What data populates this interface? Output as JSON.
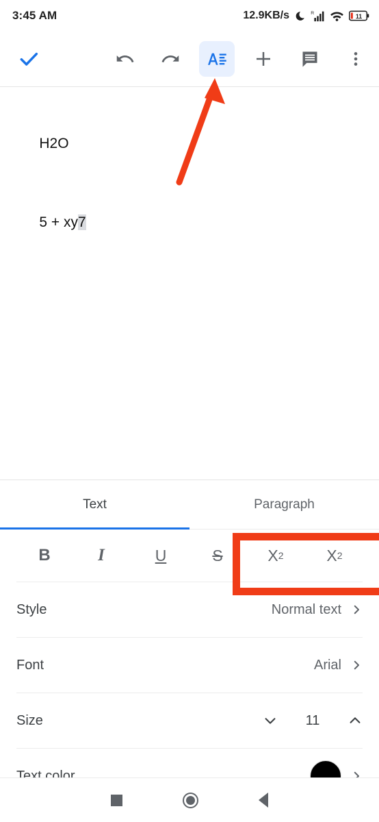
{
  "status_bar": {
    "time": "3:45 AM",
    "network_speed": "12.9KB/s",
    "dnd_icon": "moon-icon",
    "signal_icon": "cellular-signal-icon",
    "signal_roaming_label": "R",
    "wifi_icon": "wifi-icon",
    "battery_icon": "battery-icon",
    "battery_level": "11"
  },
  "toolbar": {
    "done_label": "done-checkmark",
    "undo_label": "undo",
    "redo_label": "redo",
    "format_label": "format",
    "insert_label": "insert",
    "comment_label": "comment",
    "more_label": "more-options",
    "format_active": true,
    "accent_color": "#1a73e8",
    "format_bg_color": "#e8f0fe"
  },
  "document": {
    "lines": [
      {
        "text": "H2O",
        "selected": ""
      },
      {
        "text": "5 + xy",
        "selected": "7"
      }
    ]
  },
  "format_panel": {
    "tabs": [
      {
        "label": "Text",
        "active": true
      },
      {
        "label": "Paragraph",
        "active": false
      }
    ],
    "style_buttons": [
      {
        "name": "bold",
        "label": "B"
      },
      {
        "name": "italic",
        "label": "I"
      },
      {
        "name": "underline",
        "label": "U"
      },
      {
        "name": "strikethrough",
        "label": "S"
      },
      {
        "name": "superscript",
        "label": "X"
      },
      {
        "name": "subscript",
        "label": "X"
      }
    ],
    "superscript_exponent": "2",
    "subscript_index": "2",
    "rows": [
      {
        "label": "Style",
        "value": "Normal text"
      },
      {
        "label": "Font",
        "value": "Arial"
      },
      {
        "label": "Size",
        "value": "11"
      },
      {
        "label": "Text color",
        "value": "#000000"
      }
    ]
  },
  "annotations": {
    "arrow_color": "#f03c17",
    "box_color": "#f03c17",
    "arrow_target": "format-toolbar-button",
    "box_target": "superscript-subscript-buttons"
  },
  "nav_bar": {
    "recents_label": "recents",
    "home_label": "home",
    "back_label": "back"
  }
}
